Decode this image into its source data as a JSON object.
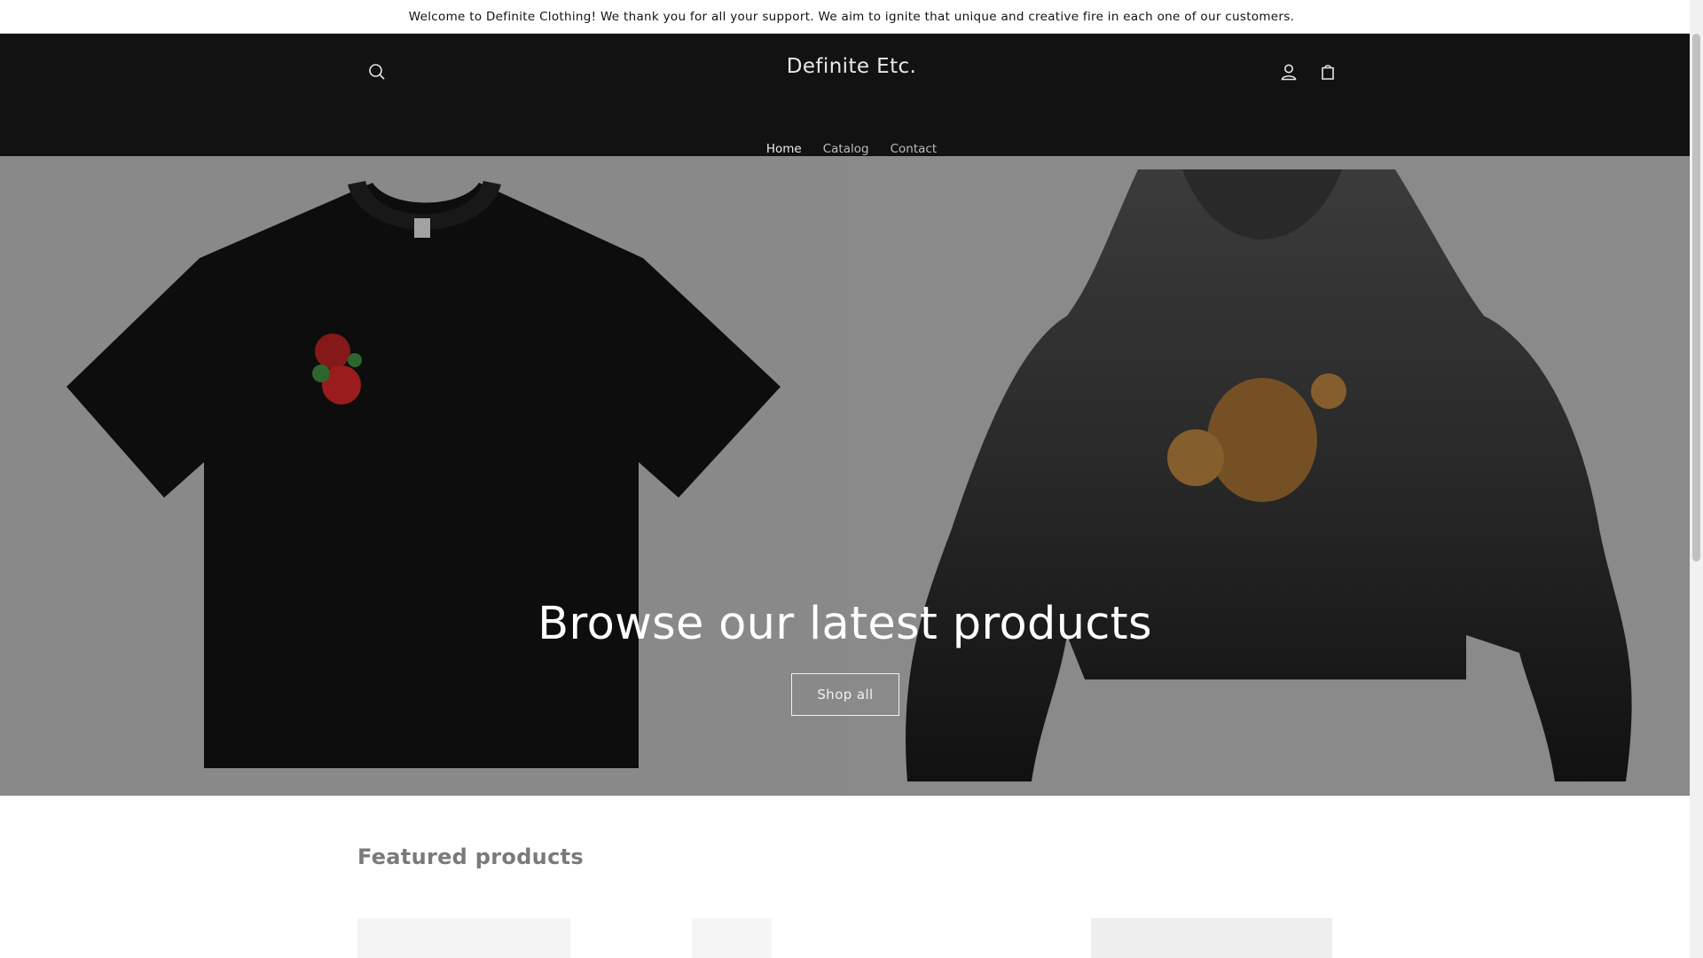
{
  "announcement": {
    "text": "Welcome to Definite Clothing! We thank you for all your support. We aim to ignite that unique and creative fire in each one of our customers."
  },
  "header": {
    "brand": "Definite Etc.",
    "search_icon": "search-icon",
    "account_icon": "account-icon",
    "cart_icon": "cart-icon"
  },
  "nav": {
    "items": [
      {
        "label": "Home",
        "active": true
      },
      {
        "label": "Catalog",
        "active": false
      },
      {
        "label": "Contact",
        "active": false
      }
    ]
  },
  "hero": {
    "title": "Browse our latest products",
    "button_label": "Shop all",
    "left_image": "black t-shirt with red roses embroidery",
    "right_image": "black faded hoodie with teddy bear print"
  },
  "featured": {
    "heading": "Featured products"
  },
  "colors": {
    "header_bg": "#121212",
    "hero_bg": "#909090",
    "text_light": "#ffffff"
  }
}
